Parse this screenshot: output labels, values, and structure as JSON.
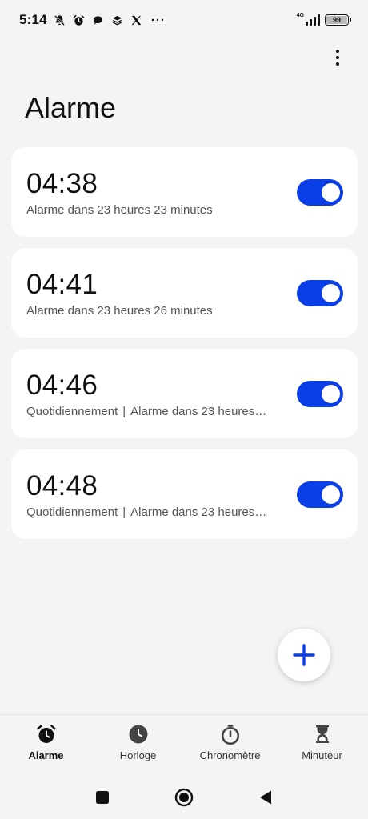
{
  "status_bar": {
    "time": "5:14",
    "network": "4G",
    "battery": "99",
    "battery_level": 0.99
  },
  "header": {
    "title": "Alarme"
  },
  "alarms": [
    {
      "time": "04:38",
      "repeat": "",
      "subtitle": "Alarme dans 23 heures 23 minutes",
      "enabled": true
    },
    {
      "time": "04:41",
      "repeat": "",
      "subtitle": "Alarme dans 23 heures 26 minutes",
      "enabled": true
    },
    {
      "time": "04:46",
      "repeat": "Quotidiennement",
      "subtitle": "Alarme dans 23 heures…",
      "enabled": true
    },
    {
      "time": "04:48",
      "repeat": "Quotidiennement",
      "subtitle": "Alarme dans 23 heures…",
      "enabled": true
    }
  ],
  "bottom_nav": {
    "items": [
      {
        "label": "Alarme",
        "icon": "alarm-clock-icon",
        "active": true
      },
      {
        "label": "Horloge",
        "icon": "clock-icon",
        "active": false
      },
      {
        "label": "Chronomètre",
        "icon": "stopwatch-icon",
        "active": false
      },
      {
        "label": "Minuteur",
        "icon": "hourglass-icon",
        "active": false
      }
    ]
  },
  "colors": {
    "accent": "#0a3fe8",
    "background": "#f4f4f4",
    "card": "#ffffff"
  }
}
